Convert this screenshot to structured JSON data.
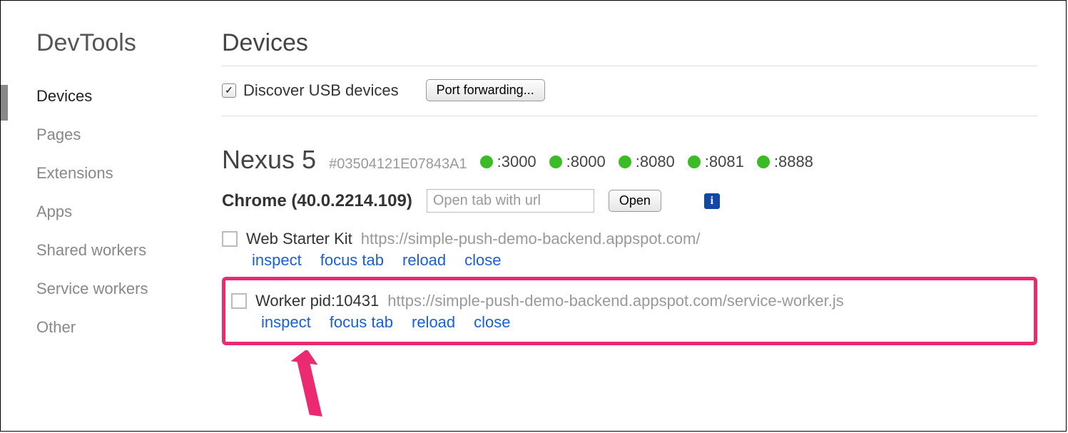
{
  "sidebar": {
    "title": "DevTools",
    "items": [
      {
        "label": "Devices",
        "active": true
      },
      {
        "label": "Pages"
      },
      {
        "label": "Extensions"
      },
      {
        "label": "Apps"
      },
      {
        "label": "Shared workers"
      },
      {
        "label": "Service workers"
      },
      {
        "label": "Other"
      }
    ]
  },
  "main": {
    "title": "Devices",
    "discover": {
      "checked": true,
      "label": "Discover USB devices"
    },
    "port_forwarding_button": "Port forwarding...",
    "device": {
      "name": "Nexus 5",
      "serial": "#03504121E07843A1",
      "ports": [
        ":3000",
        ":8000",
        ":8080",
        ":8081",
        ":8888"
      ]
    },
    "browser": {
      "label": "Chrome (40.0.2214.109)",
      "url_placeholder": "Open tab with url",
      "open_button": "Open"
    },
    "tabs": [
      {
        "title": "Web Starter Kit",
        "url": "https://simple-push-demo-backend.appspot.com/",
        "highlighted": false
      },
      {
        "title": "Worker pid:10431",
        "url": "https://simple-push-demo-backend.appspot.com/service-worker.js",
        "highlighted": true
      }
    ],
    "actions": {
      "inspect": "inspect",
      "focus_tab": "focus tab",
      "reload": "reload",
      "close": "close"
    }
  },
  "colors": {
    "highlight": "#ec2a72",
    "port_dot": "#3bbb26",
    "link": "#1a5fd6"
  }
}
